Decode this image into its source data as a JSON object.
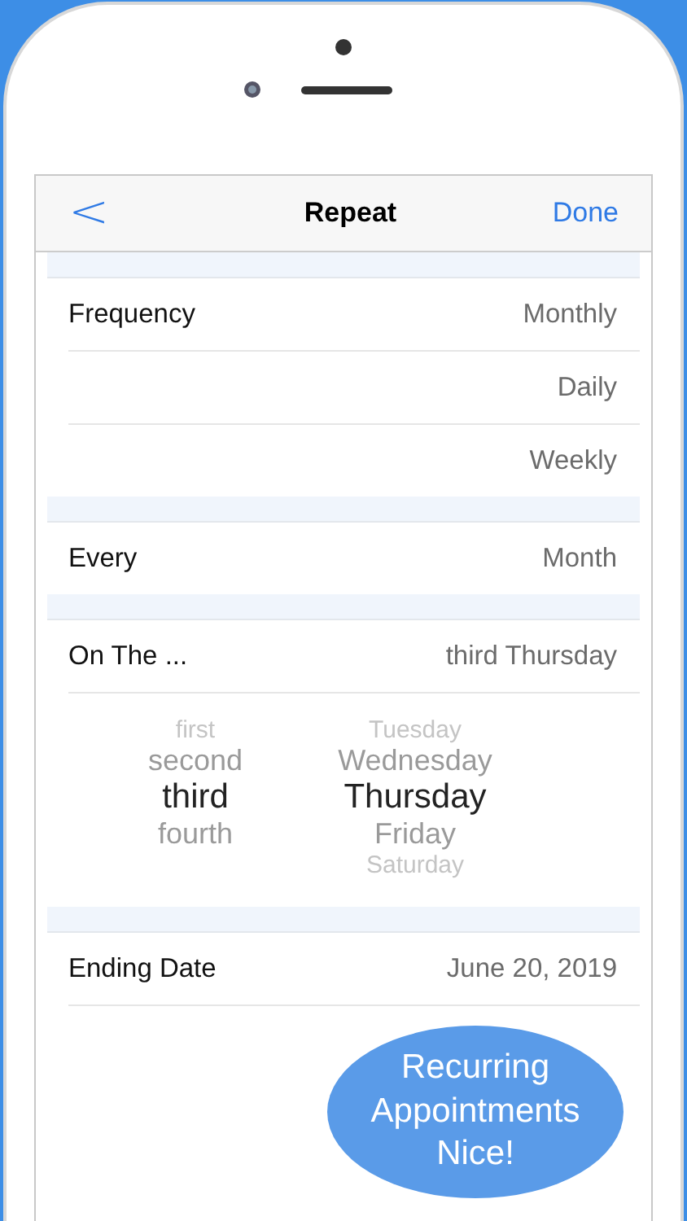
{
  "nav": {
    "back": "<",
    "title": "Repeat",
    "done": "Done"
  },
  "sections": [
    {
      "rows": [
        {
          "label": "Frequency",
          "value": "Monthly"
        },
        {
          "value": "Daily"
        },
        {
          "value": "Weekly"
        }
      ]
    },
    {
      "rows": [
        {
          "label": "Every",
          "value": "Month"
        }
      ]
    },
    {
      "rows": [
        {
          "label": "On The ...",
          "value": "third Thursday"
        }
      ],
      "picker": [
        {
          "items": [
            {
              "text": "first",
              "selected": false
            },
            {
              "text": "second",
              "selected": false
            },
            {
              "text": "third",
              "selected": true
            },
            {
              "text": "fourth",
              "selected": false
            }
          ]
        },
        {
          "items": [
            {
              "text": "Tuesday",
              "selected": false
            },
            {
              "text": "Wednesday",
              "selected": false
            },
            {
              "text": "Thursday",
              "selected": true
            },
            {
              "text": "Friday",
              "selected": false
            },
            {
              "text": "Saturday",
              "selected": false
            }
          ]
        }
      ]
    },
    {
      "rows": [
        {
          "label": "Ending Date",
          "value": "June 20, 2019"
        }
      ]
    }
  ],
  "bubble": "Recurring Appointments Nice!"
}
